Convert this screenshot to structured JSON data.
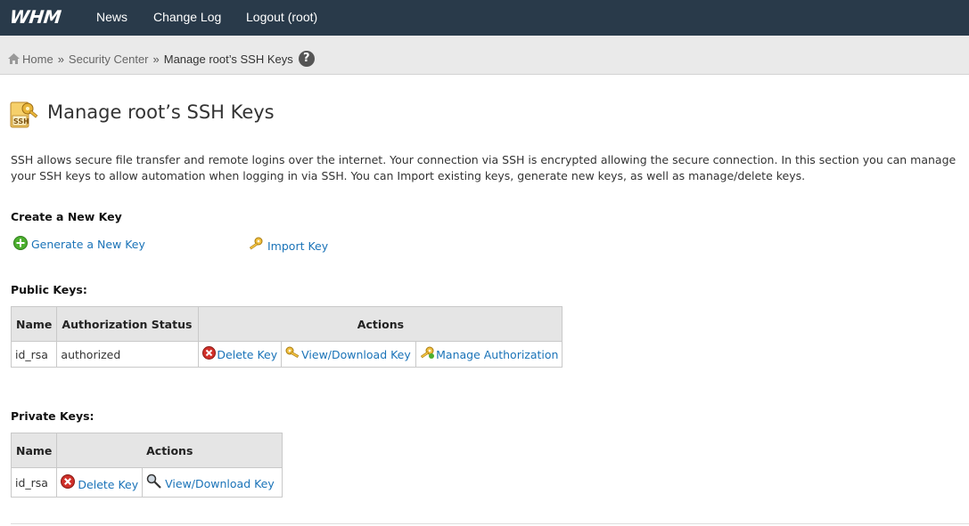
{
  "topbar": {
    "logo": "WHM",
    "nav": [
      "News",
      "Change Log",
      "Logout (root)"
    ]
  },
  "breadcrumb": {
    "home": "Home",
    "section": "Security Center",
    "current": "Manage root’s SSH Keys",
    "help": "?"
  },
  "page": {
    "title": "Manage root’s SSH Keys",
    "description": "SSH allows secure file transfer and remote logins over the internet. Your connection via SSH is encrypted allowing the secure connection. In this section you can manage your SSH keys to allow automation when logging in via SSH. You can Import existing keys, generate new keys, as well as manage/delete keys."
  },
  "create": {
    "heading": "Create a New Key",
    "generate_label": "Generate a New Key",
    "import_label": "Import Key"
  },
  "public_keys": {
    "heading": "Public Keys:",
    "col_name": "Name",
    "col_status": "Authorization Status",
    "col_actions": "Actions",
    "rows": [
      {
        "name": "id_rsa",
        "status": "authorized",
        "delete": "Delete Key",
        "view": "View/Download Key",
        "manage": "Manage Authorization"
      }
    ]
  },
  "private_keys": {
    "heading": "Private Keys:",
    "col_name": "Name",
    "col_actions": "Actions",
    "rows": [
      {
        "name": "id_rsa",
        "delete": "Delete Key",
        "view": "View/Download Key"
      }
    ]
  },
  "colors": {
    "topbar": "#293a4a",
    "link": "#1a73b8",
    "breadcrumb_bg": "#eaeaea",
    "table_header": "#e5e5e5"
  }
}
